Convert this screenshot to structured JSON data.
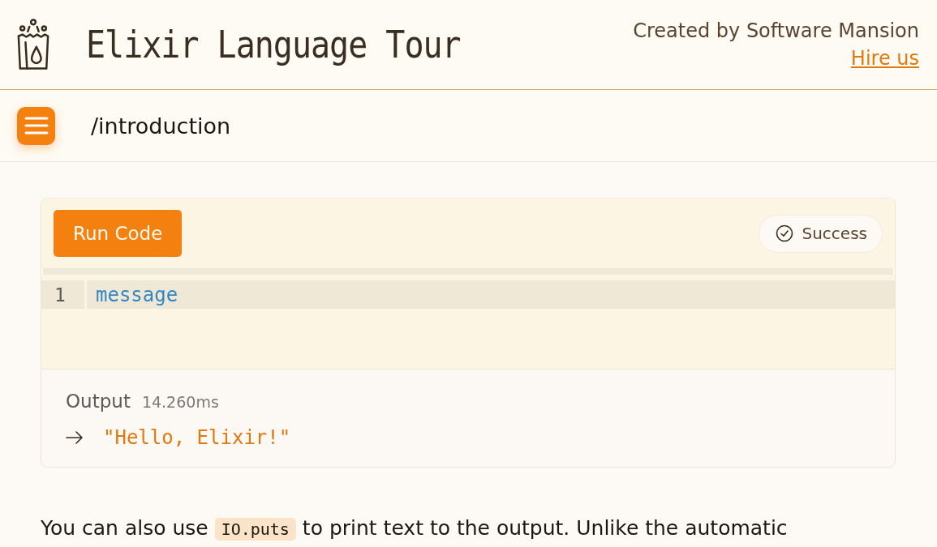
{
  "header": {
    "title": "Elixir Language Tour",
    "credit": "Created by Software Mansion",
    "link": "Hire us"
  },
  "nav": {
    "path": "/introduction"
  },
  "editor": {
    "run_button": "Run Code",
    "status": {
      "kind": "success",
      "label": "Success"
    },
    "lines": [
      {
        "number": "1",
        "code": "message",
        "highlighted": true
      }
    ],
    "output": {
      "label": "Output",
      "time": "14.260ms",
      "result": "\"Hello, Elixir!\""
    }
  },
  "paragraph": [
    {
      "kind": "text",
      "text": "You can also use "
    },
    {
      "kind": "code",
      "text": "IO.puts"
    },
    {
      "kind": "text",
      "text": " to print text to the output. Unlike the automatic"
    }
  ]
}
